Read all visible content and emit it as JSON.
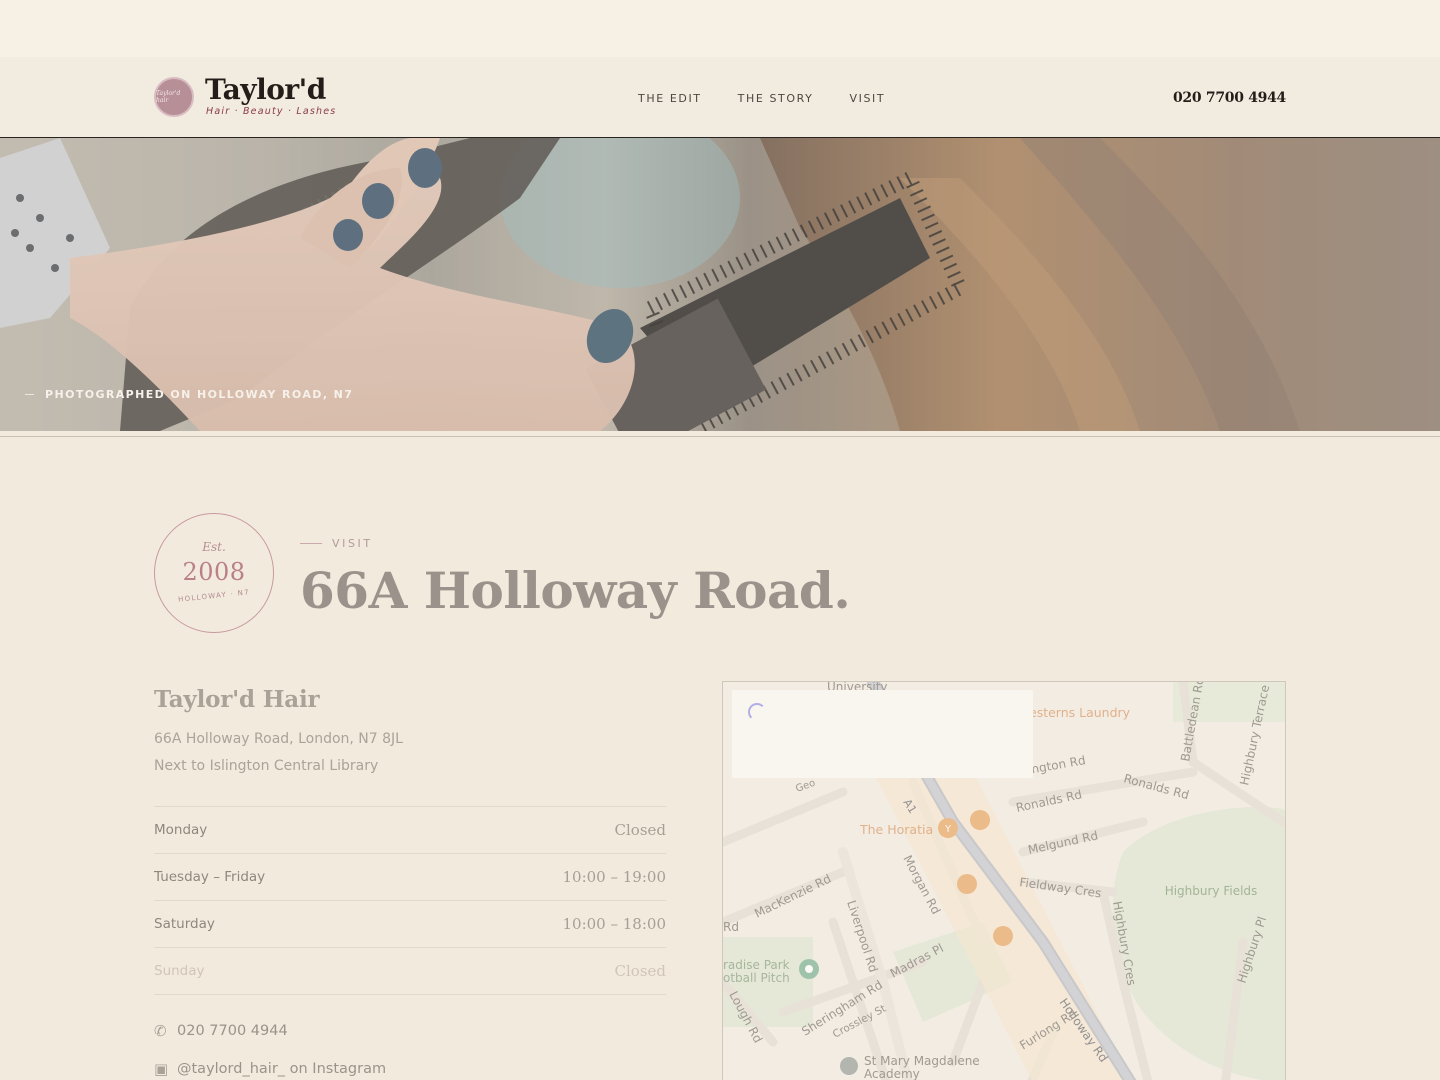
{
  "header": {
    "logo_name": "Taylor'd",
    "logo_tagline": "Hair · Beauty · Lashes",
    "logo_mark_text": "Taylor'd hair",
    "nav": [
      "THE EDIT",
      "THE STORY",
      "VISIT"
    ],
    "phone": "020 7700 4944"
  },
  "hero": {
    "caption": "PHOTOGRAPHED ON HOLLOWAY ROAD, N7"
  },
  "badge": {
    "est": "Est.",
    "year": "2008",
    "place": "HOLLOWAY · N7"
  },
  "visit": {
    "eyebrow": "VISIT",
    "title": "66A Holloway Road.",
    "salon_name": "Taylor'd Hair",
    "address": "66A Holloway Road, London, N7 8JL",
    "directions": "Next to Islington Central Library"
  },
  "hours": [
    {
      "day": "Monday",
      "time": "Closed"
    },
    {
      "day": "Tuesday – Friday",
      "time": "10:00 – 19:00"
    },
    {
      "day": "Saturday",
      "time": "10:00 – 18:00"
    },
    {
      "day": "Sunday",
      "time": "Closed"
    }
  ],
  "contact": {
    "phone": "020 7700 4944",
    "instagram": "@taylord_hair_ on Instagram",
    "phone_icon": "phone-icon",
    "instagram_icon": "camera-icon"
  },
  "map": {
    "labels": {
      "university": "University",
      "laundry": "esterns Laundry",
      "battledean": "Battledean Rd",
      "highbury_terrace": "Highbury Terrace",
      "ronalds_rd_1": "Ronalds Rd",
      "ronalds_rd_2": "Ronalds Rd",
      "ington_rd": "ington Rd",
      "melgund": "Melgund Rd",
      "the_horatia": "The Horatia",
      "a1": "A1",
      "morgan": "Morgan Rd",
      "fieldway": "Fieldway Cres",
      "highbury_fields": "Highbury Fields",
      "highbury_cres": "Highbury Cres",
      "highbury_pl": "Highbury Pl",
      "mackenzie": "MacKenzie Rd",
      "liverpool": "Liverpool Rd",
      "madras": "Madras Pl",
      "paradise_park": "radise Park",
      "football_pitch": "otball Pitch",
      "lough": "Lough Rd",
      "sheringham": "Sheringham Rd",
      "crossley": "Crossley St",
      "holloway": "Holloway Rd",
      "furlong": "Furlong Rd",
      "st_mary": "St Mary Magdalene",
      "academy": "Academy",
      "rd_left": "Rd",
      "geo": "Geo"
    }
  },
  "colors": {
    "background": "#f3eade",
    "header_bg": "#f1ebe0",
    "accent_rose": "#b98088",
    "ink": "#231c18"
  }
}
